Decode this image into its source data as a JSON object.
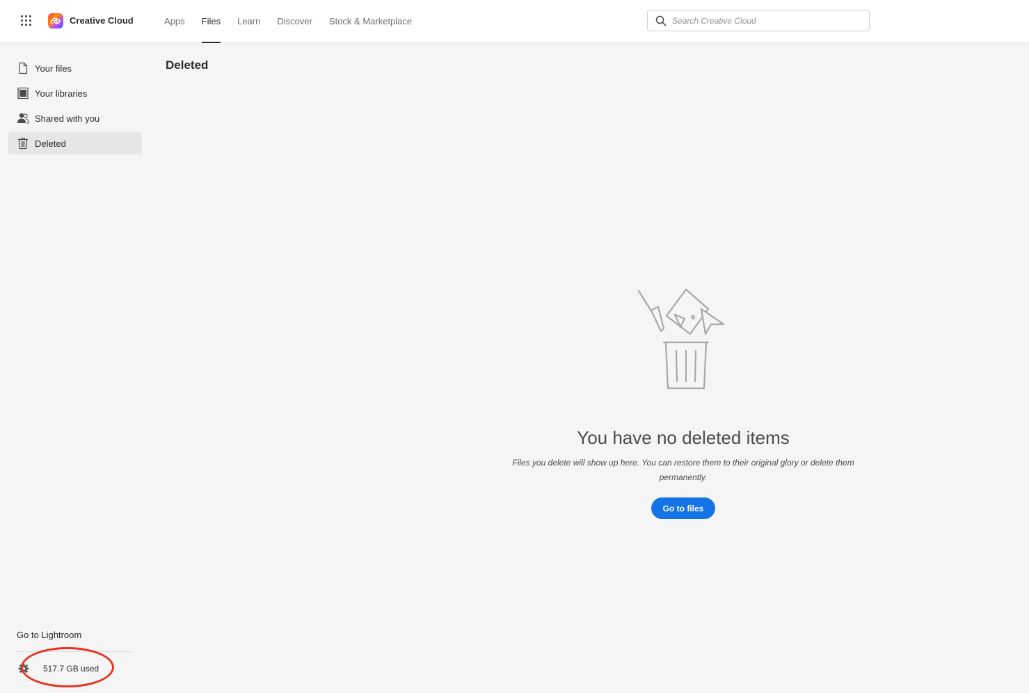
{
  "header": {
    "brand": "Creative Cloud",
    "nav": [
      {
        "label": "Apps"
      },
      {
        "label": "Files"
      },
      {
        "label": "Learn"
      },
      {
        "label": "Discover"
      },
      {
        "label": "Stock & Marketplace"
      }
    ],
    "active_nav": "Files",
    "search": {
      "placeholder": "Search Creative Cloud",
      "value": ""
    }
  },
  "sidebar": {
    "items": [
      {
        "label": "Your files",
        "icon": "file-icon"
      },
      {
        "label": "Your libraries",
        "icon": "library-icon"
      },
      {
        "label": "Shared with you",
        "icon": "people-icon"
      },
      {
        "label": "Deleted",
        "icon": "trash-icon",
        "active": true
      }
    ],
    "lightroom_link": "Go to Lightroom",
    "storage": {
      "text": "517.7 GB used",
      "icon": "gear-icon"
    }
  },
  "main": {
    "title": "Deleted",
    "empty_state": {
      "illustration": "trash-illustration",
      "heading": "You have no deleted items",
      "description": "Files you delete will show up here. You can restore them to their original glory or delete them permanently.",
      "button_label": "Go to files"
    }
  },
  "colors": {
    "accent": "#1473e6",
    "annotation": "#e8321f",
    "sidebar_active": "#e6e6e6",
    "background": "#f5f5f5"
  }
}
